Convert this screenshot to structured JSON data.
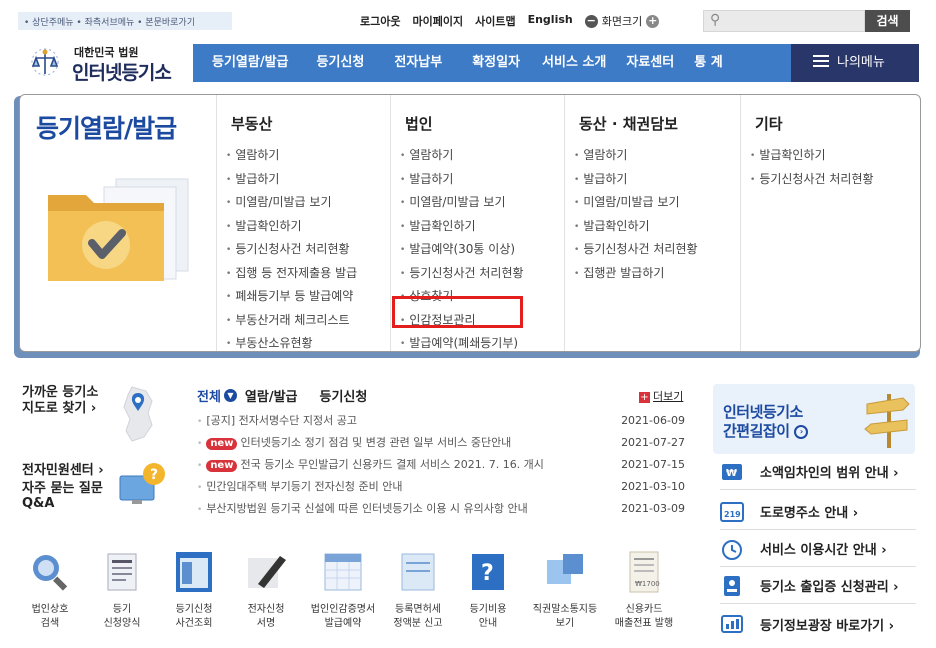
{
  "skip_links": "• 상단주메뉴 • 좌측서브메뉴 • 본문바로가기",
  "top_links": {
    "logout": "로그아웃",
    "mypage": "마이페이지",
    "sitemap": "사이트맵",
    "english": "English",
    "fontsize": "화면크기"
  },
  "search": {
    "placeholder": "",
    "button": "검색"
  },
  "logo": {
    "sub": "대한민국 법원",
    "main": "인터넷등기소"
  },
  "gnb": [
    "등기열람/발급",
    "등기신청",
    "전자납부",
    "확정일자",
    "서비스 소개",
    "자료센터",
    "통 계"
  ],
  "my_menu": "나의메뉴",
  "mega": {
    "title": "등기열람/발급",
    "columns": [
      {
        "heading": "부동산",
        "items": [
          "열람하기",
          "발급하기",
          "미열람/미발급 보기",
          "발급확인하기",
          "등기신청사건 처리현황",
          "집행 등 전자제출용 발급",
          "폐쇄등기부 등 발급예약",
          "부동산거래 체크리스트",
          "부동산소유현황"
        ]
      },
      {
        "heading": "법인",
        "items": [
          "열람하기",
          "발급하기",
          "미열람/미발급 보기",
          "발급확인하기",
          "발급예약(30통 이상)",
          "등기신청사건 처리현황",
          "상호찾기",
          "인감정보관리",
          "발급예약(폐쇄등기부)"
        ]
      },
      {
        "heading": "동산 · 채권담보",
        "items": [
          "열람하기",
          "발급하기",
          "미열람/미발급 보기",
          "발급확인하기",
          "등기신청사건 처리현황",
          "집행관 발급하기"
        ]
      },
      {
        "heading": "기타",
        "items": [
          "발급확인하기",
          "등기신청사건 처리현황"
        ]
      }
    ]
  },
  "quick": {
    "nearby1": "가까운 등기소",
    "nearby2": "지도로 찾기 ›",
    "center": "전자민원센터 ›",
    "faq1": "자주 묻는 질문",
    "faq2": "Q&A"
  },
  "notice_tabs": {
    "all": "전체",
    "view": "열람/발급",
    "apply": "등기신청",
    "more": "더보기"
  },
  "notices": [
    {
      "new": false,
      "title": "[공지] 전자서명수단 지정서 공고",
      "date": "2021-06-09"
    },
    {
      "new": true,
      "title": "인터넷등기소 정기 점검 및 변경 관련 일부 서비스 중단안내",
      "date": "2021-07-27"
    },
    {
      "new": true,
      "title": "전국 등기소 무인발급기 신용카드 결제 서비스 2021. 7. 16. 개시",
      "date": "2021-07-15"
    },
    {
      "new": false,
      "title": "민간임대주택 부기등기 전자신청 준비 안내",
      "date": "2021-03-10"
    },
    {
      "new": false,
      "title": "부산지방법원 등기국 신설에 따른 인터넷등기소 이용 시 유의사항 안내",
      "date": "2021-03-09"
    }
  ],
  "new_badge": "new",
  "banner": {
    "line1": "인터넷등기소",
    "line2": "간편길잡이"
  },
  "side_links": [
    "소액임차인의 범위 안내 ›",
    "도로명주소 안내 ›",
    "서비스 이용시간 안내 ›",
    "등기소 출입증 신청관리 ›",
    "등기정보광장 바로가기 ›"
  ],
  "bottom_icons": [
    [
      "법인상호",
      "검색"
    ],
    [
      "등기",
      "신청양식"
    ],
    [
      "등기신청",
      "사건조회"
    ],
    [
      "전자신청",
      "서명"
    ],
    [
      "법인인감증명서",
      "발급예약"
    ],
    [
      "등록면허세",
      "정액분 신고"
    ],
    [
      "등기비용",
      "안내"
    ],
    [
      "직권말소통지등",
      "보기"
    ],
    [
      "신용카드",
      "매출전표 발행"
    ]
  ],
  "colors": {
    "gnb": "#3d7bc7",
    "mymenu": "#29366a",
    "title": "#1c4aa1",
    "highlight": "#e41d1d"
  }
}
